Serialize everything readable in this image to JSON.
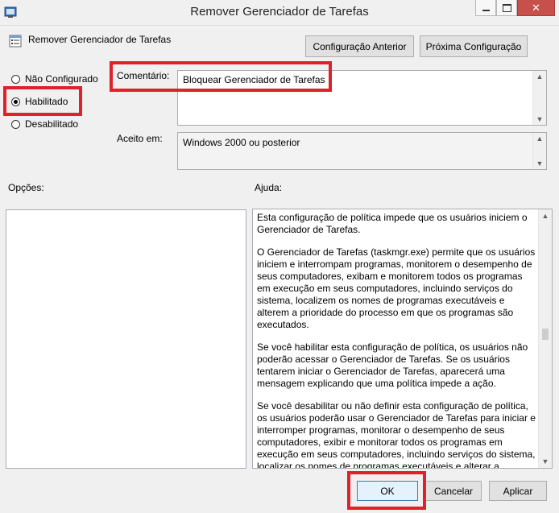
{
  "window": {
    "title": "Remover Gerenciador de Tarefas"
  },
  "header": {
    "policy_name": "Remover Gerenciador de Tarefas",
    "prev_button": "Configuração Anterior",
    "next_button": "Próxima Configuração"
  },
  "state": {
    "options": [
      {
        "label": "Não Configurado",
        "selected": false
      },
      {
        "label": "Habilitado",
        "selected": true
      },
      {
        "label": "Desabilitado",
        "selected": false
      }
    ]
  },
  "comment": {
    "label": "Comentário:",
    "value": "Bloquear Gerenciador de Tarefas"
  },
  "supported": {
    "label": "Aceito em:",
    "value": "Windows 2000 ou posterior"
  },
  "options_section": {
    "label": "Opções:"
  },
  "help_section": {
    "label": "Ajuda:",
    "paragraphs": [
      "Esta configuração de política impede que os usuários iniciem o Gerenciador de Tarefas.",
      "O Gerenciador de Tarefas (taskmgr.exe) permite que os usuários iniciem e interrompam programas, monitorem o desempenho de seus computadores, exibam e monitorem todos os programas em execução em seus computadores, incluindo serviços do sistema, localizem os nomes de programas executáveis e alterem a prioridade do processo em que os programas são executados.",
      "Se você habilitar esta configuração de política, os usuários não poderão acessar o Gerenciador de Tarefas. Se os usuários tentarem iniciar o Gerenciador de Tarefas, aparecerá uma mensagem explicando que uma política impede a ação.",
      "Se você desabilitar ou não definir esta configuração de política, os usuários poderão usar o Gerenciador de Tarefas para iniciar e interromper programas, monitorar o desempenho de seus computadores, exibir e monitorar todos os programas em execução em seus computadores, incluindo serviços do sistema, localizar os nomes de programas executáveis e alterar a"
    ]
  },
  "footer": {
    "ok": "OK",
    "cancel": "Cancelar",
    "apply": "Aplicar"
  },
  "colors": {
    "highlight": "#e0202a",
    "close": "#c7504b"
  }
}
